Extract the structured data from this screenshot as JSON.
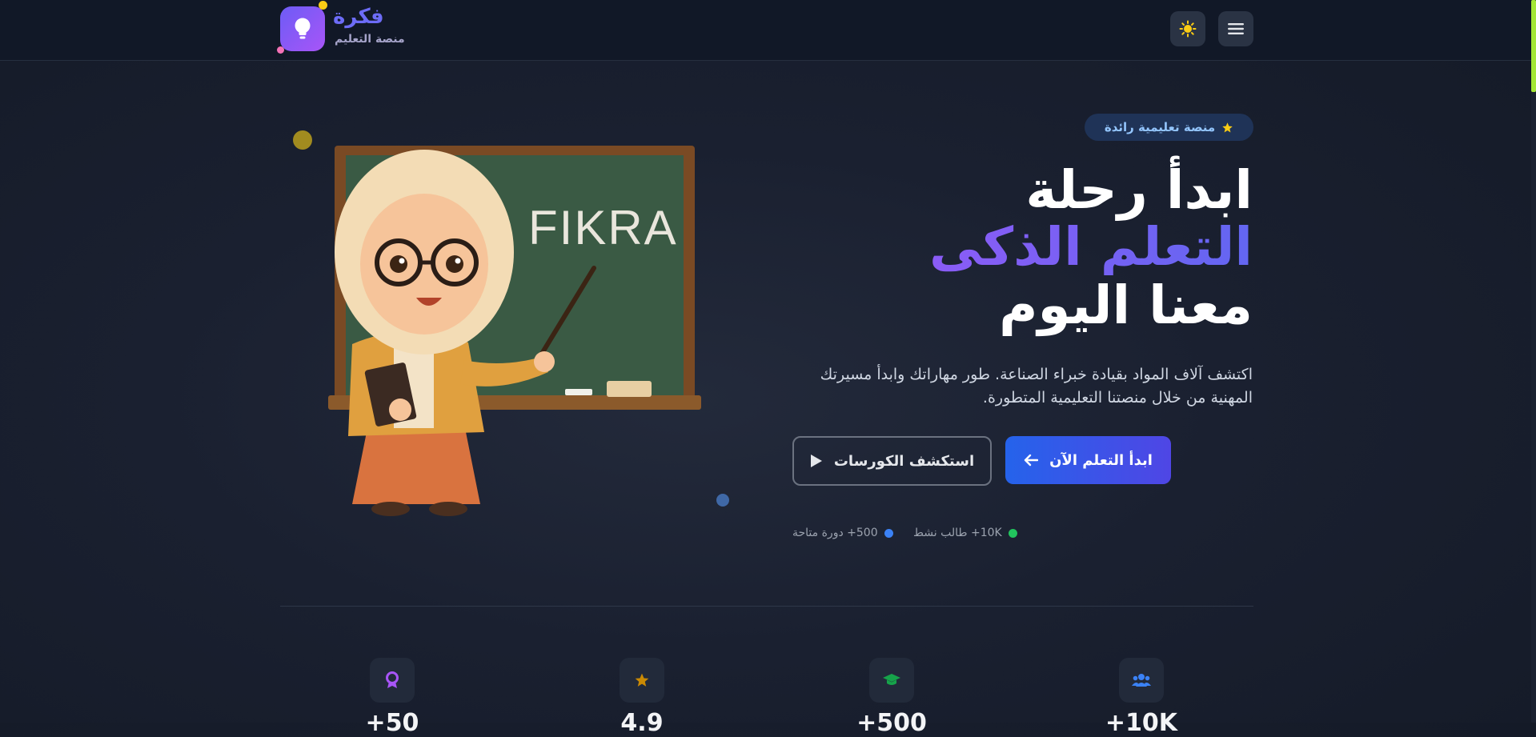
{
  "header": {
    "brand_name": "فكرة",
    "brand_subtitle": "منصة التعليم",
    "theme_icon": "sun-icon",
    "menu_icon": "menu-icon",
    "logo_icon": "lightbulb-icon"
  },
  "hero": {
    "badge_label": "منصة تعليمية رائدة",
    "badge_icon": "star-icon",
    "title_line1": "ابدأ رحلة",
    "title_line2": "التعلم الذكى",
    "title_line3": "معنا اليوم",
    "description": "اكتشف آلاف المواد بقيادة خبراء الصناعة. طور مهاراتك وابدأ مسيرتك المهنية من خلال منصتنا التعليمية المتطورة.",
    "primary_button": "ابدأ التعلم الآن",
    "secondary_button": "استكشف الكورسات",
    "stat_students": "10K+ طالب نشط",
    "stat_courses": "500+ دورة متاحة",
    "illustration_text": "FIKRA"
  },
  "features": [
    {
      "icon": "users-icon",
      "value": "10K+"
    },
    {
      "icon": "graduation-cap-icon",
      "value": "500+"
    },
    {
      "icon": "star-icon",
      "value": "4.9"
    },
    {
      "icon": "award-icon",
      "value": "50+"
    }
  ],
  "colors": {
    "accent_blue": "#2563eb",
    "accent_purple": "#8b5cf6",
    "badge_bg": "#1f3357",
    "green_dot": "#22c55e",
    "blue_dot": "#3b82f6",
    "sun_yellow": "#facc15",
    "scroll_thumb": "#a3e635"
  }
}
